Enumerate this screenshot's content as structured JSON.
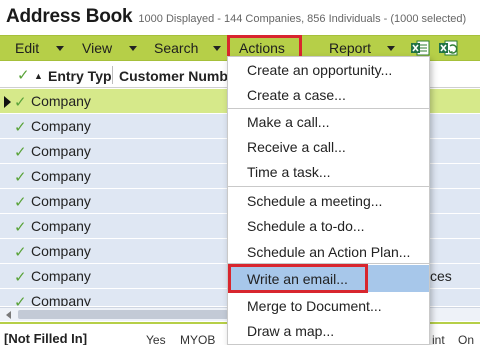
{
  "window": {
    "title": "Address Book",
    "subtitle": "1000 Displayed - 144 Companies, 856 Individuals - (1000 selected)"
  },
  "toolbar": {
    "items": [
      {
        "label": "Edit"
      },
      {
        "label": "View"
      },
      {
        "label": "Search"
      },
      {
        "label": "Actions"
      },
      {
        "label": "Report"
      }
    ],
    "icons": [
      "excel-icon",
      "excel-export-icon"
    ]
  },
  "grid": {
    "columns": [
      {
        "label": "Entry Typ"
      },
      {
        "label": "Customer Numbe"
      }
    ],
    "rows": [
      {
        "entry_type": "Company"
      },
      {
        "entry_type": "Company"
      },
      {
        "entry_type": "Company"
      },
      {
        "entry_type": "Company"
      },
      {
        "entry_type": "Company"
      },
      {
        "entry_type": "Company"
      },
      {
        "entry_type": "Company",
        "right_text": "ces"
      },
      {
        "entry_type": "Company"
      }
    ]
  },
  "footer": {
    "label": "[Not Filled In]",
    "extra_a": "Yes",
    "extra_b": "MYOB",
    "extra_c": "int",
    "extra_d": "On"
  },
  "actions_menu": {
    "groups": [
      [
        "Create an opportunity...",
        "Create a case..."
      ],
      [
        "Make a call...",
        "Receive a call...",
        "Time a task..."
      ],
      [
        "Schedule a meeting...",
        "Schedule a to-do...",
        "Schedule an Action Plan..."
      ],
      [
        "Write an email...",
        "Merge to Document...",
        "Draw a map..."
      ]
    ]
  },
  "colors": {
    "toolbar": "#b6cf48",
    "row": "#dfe7f3",
    "selected_row": "#d6e98a",
    "menu_hover": "#a7c7ea",
    "highlight": "#d8262e",
    "check": "#5aa33a"
  }
}
